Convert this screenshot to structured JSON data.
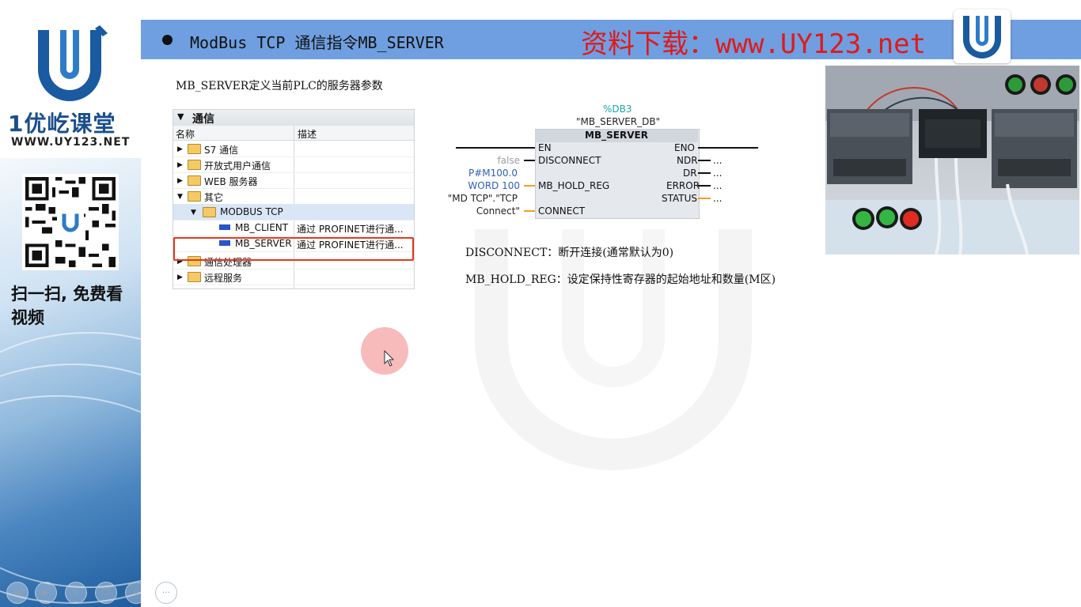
{
  "sidebar": {
    "brand_name": "1优屹课堂",
    "brand_url": "WWW.UY123.NET",
    "scan_text": "扫一扫, 免费看视频"
  },
  "header": {
    "title": "ModBus TCP 通信指令MB_SERVER",
    "download": "资料下载：www.UY123.net"
  },
  "subtitle": "MB_SERVER定义当前PLC的服务器参数",
  "tree": {
    "group": "通信",
    "col_name": "名称",
    "col_desc": "描述",
    "rows": [
      {
        "label": "S7 通信",
        "desc": ""
      },
      {
        "label": "开放式用户通信",
        "desc": ""
      },
      {
        "label": "WEB 服务器",
        "desc": ""
      },
      {
        "label": "其它",
        "desc": ""
      },
      {
        "label": "MODBUS TCP",
        "desc": ""
      },
      {
        "label": "MB_CLIENT",
        "desc": "通过 PROFINET进行通..."
      },
      {
        "label": "MB_SERVER",
        "desc": "通过 PROFINET进行通..."
      },
      {
        "label": "通信处理器",
        "desc": ""
      },
      {
        "label": "远程服务",
        "desc": ""
      }
    ]
  },
  "block": {
    "db_address": "%DB3",
    "db_name": "\"MB_SERVER_DB\"",
    "title": "MB_SERVER",
    "inputs": [
      "EN",
      "DISCONNECT",
      "MB_HOLD_REG",
      "CONNECT"
    ],
    "outputs": [
      "ENO",
      "NDR",
      "DR",
      "ERROR",
      "STATUS"
    ],
    "values": {
      "disconnect": "false",
      "hold_reg_1": "P#M100.0",
      "hold_reg_2": "WORD 100",
      "connect_1": "\"MD TCP\".\"TCP",
      "connect_2": "Connect\""
    },
    "out_placeholder": "..."
  },
  "desc": {
    "line1": "DISCONNECT：断开连接(通常默认为0)",
    "line2": "MB_HOLD_REG：设定保持性寄存器的起始地址和数量(M区)"
  },
  "colors": {
    "header_bar": "#6f9fe0",
    "download_text": "#e01a1a",
    "highlight_border": "#e0391d",
    "brand_blue": "#1a4f8b"
  },
  "nav_icons": [
    "prev-icon",
    "next-icon",
    "pen-icon",
    "copy-icon",
    "zoom-icon",
    "more-icon"
  ]
}
